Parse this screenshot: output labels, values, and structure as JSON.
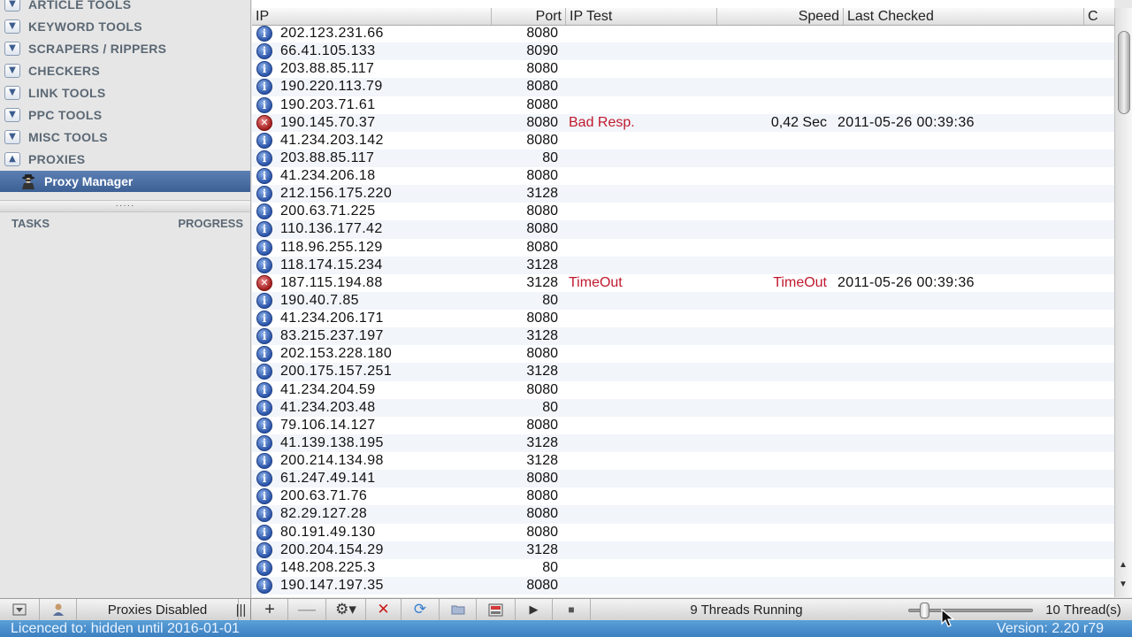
{
  "sidebar": {
    "categories": [
      {
        "label": "ARTICLE TOOLS",
        "state": "collapsed"
      },
      {
        "label": "KEYWORD TOOLS",
        "state": "collapsed"
      },
      {
        "label": "SCRAPERS / RIPPERS",
        "state": "collapsed"
      },
      {
        "label": "CHECKERS",
        "state": "collapsed"
      },
      {
        "label": "LINK TOOLS",
        "state": "collapsed"
      },
      {
        "label": "PPC TOOLS",
        "state": "collapsed"
      },
      {
        "label": "MISC TOOLS",
        "state": "collapsed"
      },
      {
        "label": "PROXIES",
        "state": "expanded"
      }
    ],
    "selected_item": "Proxy Manager",
    "splitter_grip": "·····",
    "tasks_label": "TASKS",
    "progress_label": "PROGRESS"
  },
  "table": {
    "columns": [
      "IP",
      "Port",
      "IP Test",
      "Speed",
      "Last Checked",
      "C"
    ],
    "rows": [
      {
        "status": "info",
        "ip": "202.123.231.66",
        "port": "8080",
        "test": "",
        "speed": "",
        "last": ""
      },
      {
        "status": "info",
        "ip": "66.41.105.133",
        "port": "8090",
        "test": "",
        "speed": "",
        "last": ""
      },
      {
        "status": "info",
        "ip": "203.88.85.117",
        "port": "8080",
        "test": "",
        "speed": "",
        "last": ""
      },
      {
        "status": "info",
        "ip": "190.220.113.79",
        "port": "8080",
        "test": "",
        "speed": "",
        "last": ""
      },
      {
        "status": "info",
        "ip": "190.203.71.61",
        "port": "8080",
        "test": "",
        "speed": "",
        "last": ""
      },
      {
        "status": "error",
        "ip": "190.145.70.37",
        "port": "8080",
        "test": "Bad Resp.",
        "speed": "0,42 Sec",
        "speed_error": false,
        "last": "2011-05-26 00:39:36"
      },
      {
        "status": "info",
        "ip": "41.234.203.142",
        "port": "8080",
        "test": "",
        "speed": "",
        "last": ""
      },
      {
        "status": "info",
        "ip": "203.88.85.117",
        "port": "80",
        "test": "",
        "speed": "",
        "last": ""
      },
      {
        "status": "info",
        "ip": "41.234.206.18",
        "port": "8080",
        "test": "",
        "speed": "",
        "last": ""
      },
      {
        "status": "info",
        "ip": "212.156.175.220",
        "port": "3128",
        "test": "",
        "speed": "",
        "last": ""
      },
      {
        "status": "info",
        "ip": "200.63.71.225",
        "port": "8080",
        "test": "",
        "speed": "",
        "last": ""
      },
      {
        "status": "info",
        "ip": "110.136.177.42",
        "port": "8080",
        "test": "",
        "speed": "",
        "last": ""
      },
      {
        "status": "info",
        "ip": "118.96.255.129",
        "port": "8080",
        "test": "",
        "speed": "",
        "last": ""
      },
      {
        "status": "info",
        "ip": "118.174.15.234",
        "port": "3128",
        "test": "",
        "speed": "",
        "last": ""
      },
      {
        "status": "error",
        "ip": "187.115.194.88",
        "port": "3128",
        "test": "TimeOut",
        "speed": "TimeOut",
        "speed_error": true,
        "last": "2011-05-26 00:39:36"
      },
      {
        "status": "info",
        "ip": "190.40.7.85",
        "port": "80",
        "test": "",
        "speed": "",
        "last": ""
      },
      {
        "status": "info",
        "ip": "41.234.206.171",
        "port": "8080",
        "test": "",
        "speed": "",
        "last": ""
      },
      {
        "status": "info",
        "ip": "83.215.237.197",
        "port": "3128",
        "test": "",
        "speed": "",
        "last": ""
      },
      {
        "status": "info",
        "ip": "202.153.228.180",
        "port": "8080",
        "test": "",
        "speed": "",
        "last": ""
      },
      {
        "status": "info",
        "ip": "200.175.157.251",
        "port": "3128",
        "test": "",
        "speed": "",
        "last": ""
      },
      {
        "status": "info",
        "ip": "41.234.204.59",
        "port": "8080",
        "test": "",
        "speed": "",
        "last": ""
      },
      {
        "status": "info",
        "ip": "41.234.203.48",
        "port": "80",
        "test": "",
        "speed": "",
        "last": ""
      },
      {
        "status": "info",
        "ip": "79.106.14.127",
        "port": "8080",
        "test": "",
        "speed": "",
        "last": ""
      },
      {
        "status": "info",
        "ip": "41.139.138.195",
        "port": "3128",
        "test": "",
        "speed": "",
        "last": ""
      },
      {
        "status": "info",
        "ip": "200.214.134.98",
        "port": "3128",
        "test": "",
        "speed": "",
        "last": ""
      },
      {
        "status": "info",
        "ip": "61.247.49.141",
        "port": "8080",
        "test": "",
        "speed": "",
        "last": ""
      },
      {
        "status": "info",
        "ip": "200.63.71.76",
        "port": "8080",
        "test": "",
        "speed": "",
        "last": ""
      },
      {
        "status": "info",
        "ip": "82.29.127.28",
        "port": "8080",
        "test": "",
        "speed": "",
        "last": ""
      },
      {
        "status": "info",
        "ip": "80.191.49.130",
        "port": "8080",
        "test": "",
        "speed": "",
        "last": ""
      },
      {
        "status": "info",
        "ip": "200.204.154.29",
        "port": "3128",
        "test": "",
        "speed": "",
        "last": ""
      },
      {
        "status": "info",
        "ip": "148.208.225.3",
        "port": "80",
        "test": "",
        "speed": "",
        "last": ""
      },
      {
        "status": "info",
        "ip": "190.147.197.35",
        "port": "8080",
        "test": "",
        "speed": "",
        "last": ""
      }
    ]
  },
  "toolbar": {
    "proxies_status": "Proxies Disabled",
    "threads_running": "9 Threads Running",
    "thread_count": "10 Thread(s)",
    "thread_slider_fraction": 0.1
  },
  "statusbar": {
    "licence": "Licenced to: hidden until 2016-01-01",
    "version": "Version: 2.20 r79"
  },
  "colors": {
    "error_text": "#c0192d",
    "selection": "#3c5f95",
    "statusbar": "#3c7fc0"
  }
}
